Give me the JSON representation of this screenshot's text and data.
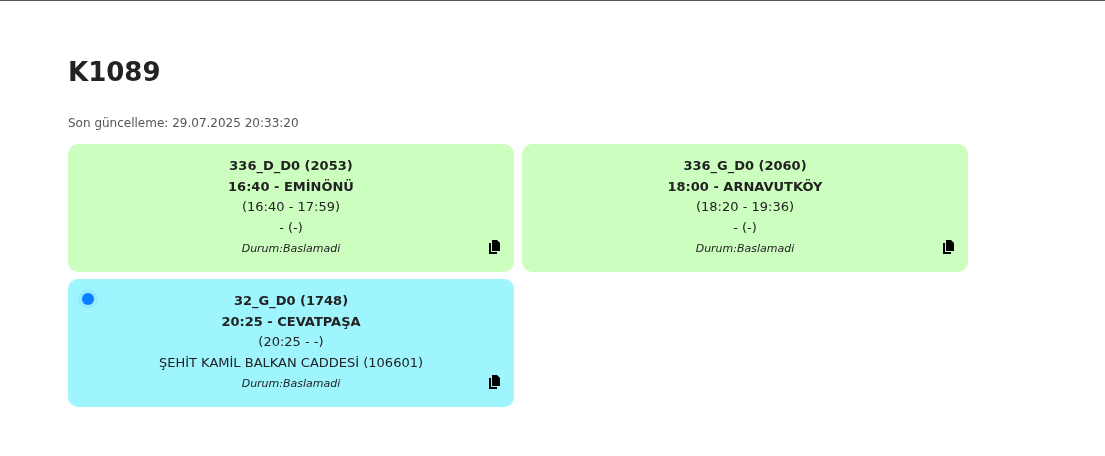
{
  "title": "K1089",
  "updated": "Son güncelleme: 29.07.2025 20:33:20",
  "trips": [
    {
      "code": "336_D_D0 (2053)",
      "departure": "16:40 - EMİNÖNÜ",
      "times": "(16:40 - 17:59)",
      "stop": "- (-)",
      "status": "Durum:Baslamadi",
      "active": false
    },
    {
      "code": "336_G_D0 (2060)",
      "departure": "18:00 - ARNAVUTKÖY",
      "times": "(18:20 - 19:36)",
      "stop": "- (-)",
      "status": "Durum:Baslamadi",
      "active": false
    },
    {
      "code": "32_G_D0 (1748)",
      "departure": "20:25 - CEVATPAŞA",
      "times": "(20:25 - -)",
      "stop": "ŞEHİT KAMİL BALKAN CADDESİ (106601)",
      "status": "Durum:Baslamadi",
      "active": true
    }
  ]
}
